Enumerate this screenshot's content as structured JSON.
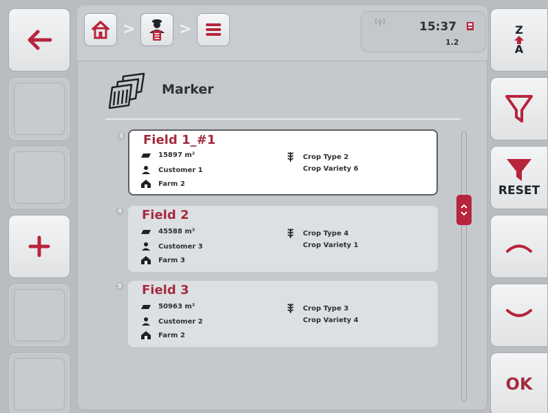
{
  "status": {
    "time": "15:37",
    "version": "1.2"
  },
  "page": {
    "title": "Marker"
  },
  "left_buttons": [
    {
      "name": "back",
      "icon": "arrow-left-icon"
    },
    {
      "name": "empty"
    },
    {
      "name": "empty"
    },
    {
      "name": "add",
      "icon": "plus-icon"
    },
    {
      "name": "empty"
    },
    {
      "name": "empty"
    }
  ],
  "right_buttons": {
    "sort": {
      "top": "Z",
      "bottom": "A"
    },
    "filter_reset_label": "RESET",
    "ok_label": "OK"
  },
  "fields": [
    {
      "index": "3",
      "name": "Field 1_#1",
      "area": "15897 m²",
      "customer": "Customer 1",
      "farm": "Farm 2",
      "crop_type": "Crop Type 2",
      "crop_variety": "Crop Variety 6",
      "selected": true
    },
    {
      "index": "4",
      "name": "Field 2",
      "area": "45588 m²",
      "customer": "Customer 3",
      "farm": "Farm 3",
      "crop_type": "Crop Type 4",
      "crop_variety": "Crop Variety 1",
      "selected": false
    },
    {
      "index": "5",
      "name": "Field 3",
      "area": "50963 m²",
      "customer": "Customer 2",
      "farm": "Farm 2",
      "crop_type": "Crop Type 3",
      "crop_variety": "Crop Variety 4",
      "selected": false
    }
  ],
  "colors": {
    "accent": "#a62b3e",
    "scroll_thumb": "#b7243b"
  }
}
